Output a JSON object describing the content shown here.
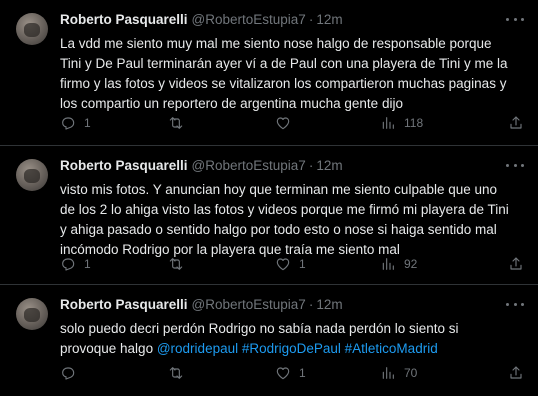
{
  "tweets": [
    {
      "author_name": "Roberto Pasquarelli",
      "handle": "@RobertoEstupia7",
      "separator": "·",
      "time": "12m",
      "text": "La vdd me siento muy mal me siento nose halgo de responsable porque Tini y De Paul terminarán ayer ví a de Paul con una playera de Tini y me la firmo y las fotos y videos se vitalizaron los compartieron muchas paginas y los compartio un reportero de argentina mucha gente dijo",
      "text_lines": [
        "La vdd me siento muy mal me siento nose halgo de responsable porque",
        "Tini y De Paul terminarán ayer ví a de Paul con una playera de Tini y me la",
        "firmo y las fotos y videos se vitalizaron los compartieron muchas paginas y",
        "los compartio un reportero de argentina mucha gente dijo"
      ],
      "replies": "1",
      "retweets": "",
      "likes": "",
      "views": "118"
    },
    {
      "author_name": "Roberto Pasquarelli",
      "handle": "@RobertoEstupia7",
      "separator": "·",
      "time": "12m",
      "text_lines": [
        "visto mis fotos. Y anuncian hoy que terminan me siento culpable que uno",
        "de los 2 lo ahiga visto las fotos y videos porque me firmó mi playera de Tini",
        "y ahiga  pasado o sentido halgo por todo esto o nose si haiga sentido mal",
        "incómodo Rodrigo por la playera que traía me siento mal"
      ],
      "replies": "1",
      "retweets": "",
      "likes": "1",
      "views": "92"
    },
    {
      "author_name": "Roberto Pasquarelli",
      "handle": "@RobertoEstupia7",
      "separator": "·",
      "time": "12m",
      "text_lines": [
        "solo puedo decri perdón Rodrigo no sabía nada perdón lo siento si",
        "provoque halgo"
      ],
      "hashtags": "@rodridepaul #RodrigoDePaul #AtleticoMadrid",
      "replies": "",
      "retweets": "",
      "likes": "1",
      "views": "70"
    }
  ],
  "icons": {
    "reply": "reply-icon",
    "retweet": "retweet-icon",
    "like": "heart-icon",
    "views": "views-icon",
    "share": "share-icon",
    "more": "more-icon"
  },
  "colors": {
    "background": "#000000",
    "text": "#e7e9ea",
    "muted": "#71767b",
    "link": "#1d9bf0",
    "divider": "#2f3336"
  }
}
